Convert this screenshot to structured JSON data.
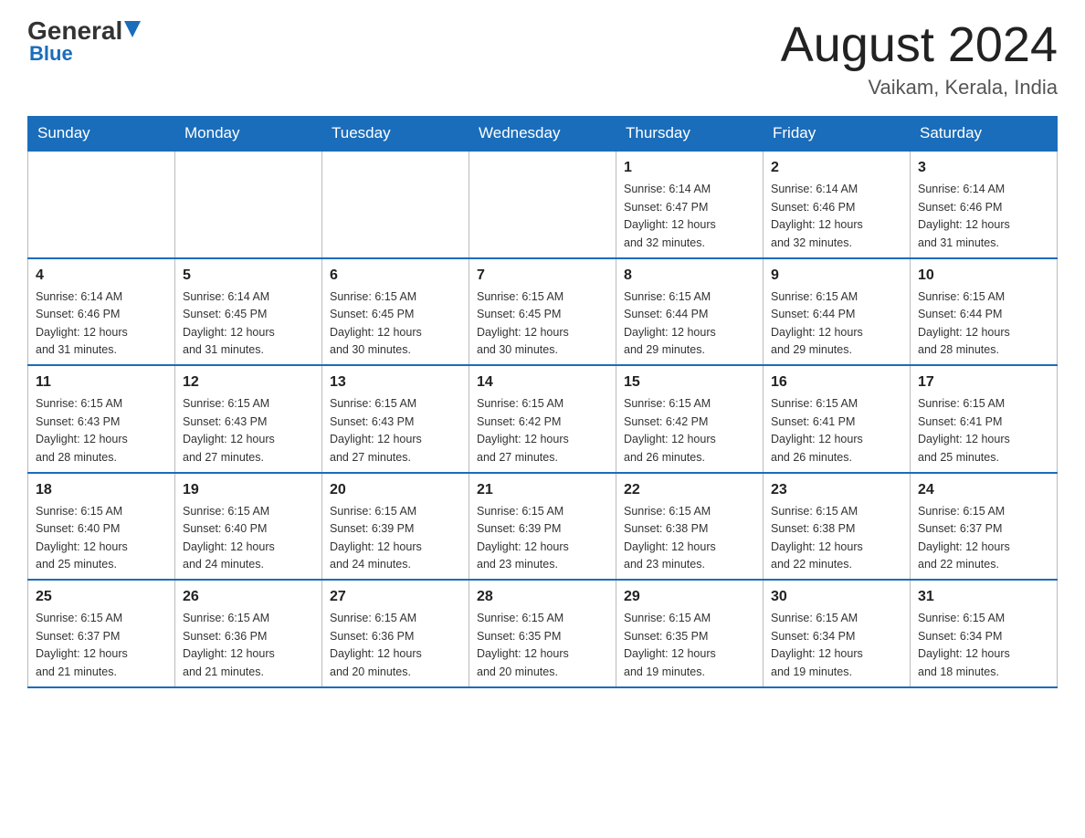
{
  "header": {
    "logo_general": "General",
    "logo_blue": "Blue",
    "month_title": "August 2024",
    "location": "Vaikam, Kerala, India"
  },
  "weekdays": [
    "Sunday",
    "Monday",
    "Tuesday",
    "Wednesday",
    "Thursday",
    "Friday",
    "Saturday"
  ],
  "weeks": [
    [
      {
        "day": "",
        "info": ""
      },
      {
        "day": "",
        "info": ""
      },
      {
        "day": "",
        "info": ""
      },
      {
        "day": "",
        "info": ""
      },
      {
        "day": "1",
        "info": "Sunrise: 6:14 AM\nSunset: 6:47 PM\nDaylight: 12 hours\nand 32 minutes."
      },
      {
        "day": "2",
        "info": "Sunrise: 6:14 AM\nSunset: 6:46 PM\nDaylight: 12 hours\nand 32 minutes."
      },
      {
        "day": "3",
        "info": "Sunrise: 6:14 AM\nSunset: 6:46 PM\nDaylight: 12 hours\nand 31 minutes."
      }
    ],
    [
      {
        "day": "4",
        "info": "Sunrise: 6:14 AM\nSunset: 6:46 PM\nDaylight: 12 hours\nand 31 minutes."
      },
      {
        "day": "5",
        "info": "Sunrise: 6:14 AM\nSunset: 6:45 PM\nDaylight: 12 hours\nand 31 minutes."
      },
      {
        "day": "6",
        "info": "Sunrise: 6:15 AM\nSunset: 6:45 PM\nDaylight: 12 hours\nand 30 minutes."
      },
      {
        "day": "7",
        "info": "Sunrise: 6:15 AM\nSunset: 6:45 PM\nDaylight: 12 hours\nand 30 minutes."
      },
      {
        "day": "8",
        "info": "Sunrise: 6:15 AM\nSunset: 6:44 PM\nDaylight: 12 hours\nand 29 minutes."
      },
      {
        "day": "9",
        "info": "Sunrise: 6:15 AM\nSunset: 6:44 PM\nDaylight: 12 hours\nand 29 minutes."
      },
      {
        "day": "10",
        "info": "Sunrise: 6:15 AM\nSunset: 6:44 PM\nDaylight: 12 hours\nand 28 minutes."
      }
    ],
    [
      {
        "day": "11",
        "info": "Sunrise: 6:15 AM\nSunset: 6:43 PM\nDaylight: 12 hours\nand 28 minutes."
      },
      {
        "day": "12",
        "info": "Sunrise: 6:15 AM\nSunset: 6:43 PM\nDaylight: 12 hours\nand 27 minutes."
      },
      {
        "day": "13",
        "info": "Sunrise: 6:15 AM\nSunset: 6:43 PM\nDaylight: 12 hours\nand 27 minutes."
      },
      {
        "day": "14",
        "info": "Sunrise: 6:15 AM\nSunset: 6:42 PM\nDaylight: 12 hours\nand 27 minutes."
      },
      {
        "day": "15",
        "info": "Sunrise: 6:15 AM\nSunset: 6:42 PM\nDaylight: 12 hours\nand 26 minutes."
      },
      {
        "day": "16",
        "info": "Sunrise: 6:15 AM\nSunset: 6:41 PM\nDaylight: 12 hours\nand 26 minutes."
      },
      {
        "day": "17",
        "info": "Sunrise: 6:15 AM\nSunset: 6:41 PM\nDaylight: 12 hours\nand 25 minutes."
      }
    ],
    [
      {
        "day": "18",
        "info": "Sunrise: 6:15 AM\nSunset: 6:40 PM\nDaylight: 12 hours\nand 25 minutes."
      },
      {
        "day": "19",
        "info": "Sunrise: 6:15 AM\nSunset: 6:40 PM\nDaylight: 12 hours\nand 24 minutes."
      },
      {
        "day": "20",
        "info": "Sunrise: 6:15 AM\nSunset: 6:39 PM\nDaylight: 12 hours\nand 24 minutes."
      },
      {
        "day": "21",
        "info": "Sunrise: 6:15 AM\nSunset: 6:39 PM\nDaylight: 12 hours\nand 23 minutes."
      },
      {
        "day": "22",
        "info": "Sunrise: 6:15 AM\nSunset: 6:38 PM\nDaylight: 12 hours\nand 23 minutes."
      },
      {
        "day": "23",
        "info": "Sunrise: 6:15 AM\nSunset: 6:38 PM\nDaylight: 12 hours\nand 22 minutes."
      },
      {
        "day": "24",
        "info": "Sunrise: 6:15 AM\nSunset: 6:37 PM\nDaylight: 12 hours\nand 22 minutes."
      }
    ],
    [
      {
        "day": "25",
        "info": "Sunrise: 6:15 AM\nSunset: 6:37 PM\nDaylight: 12 hours\nand 21 minutes."
      },
      {
        "day": "26",
        "info": "Sunrise: 6:15 AM\nSunset: 6:36 PM\nDaylight: 12 hours\nand 21 minutes."
      },
      {
        "day": "27",
        "info": "Sunrise: 6:15 AM\nSunset: 6:36 PM\nDaylight: 12 hours\nand 20 minutes."
      },
      {
        "day": "28",
        "info": "Sunrise: 6:15 AM\nSunset: 6:35 PM\nDaylight: 12 hours\nand 20 minutes."
      },
      {
        "day": "29",
        "info": "Sunrise: 6:15 AM\nSunset: 6:35 PM\nDaylight: 12 hours\nand 19 minutes."
      },
      {
        "day": "30",
        "info": "Sunrise: 6:15 AM\nSunset: 6:34 PM\nDaylight: 12 hours\nand 19 minutes."
      },
      {
        "day": "31",
        "info": "Sunrise: 6:15 AM\nSunset: 6:34 PM\nDaylight: 12 hours\nand 18 minutes."
      }
    ]
  ]
}
